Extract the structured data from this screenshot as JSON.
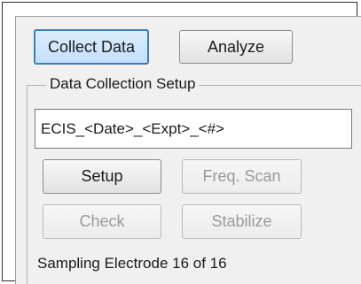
{
  "tabs": {
    "collect_label": "Collect Data",
    "analyze_label": "Analyze"
  },
  "group": {
    "label": "Data Collection Setup"
  },
  "filename_field": {
    "value": "ECIS_<Date>_<Expt>_<#>"
  },
  "buttons": {
    "setup_label": "Setup",
    "freq_scan_label": "Freq. Scan",
    "check_label": "Check",
    "stabilize_label": "Stabilize"
  },
  "status": {
    "text": "Sampling Electrode 16 of 16"
  }
}
